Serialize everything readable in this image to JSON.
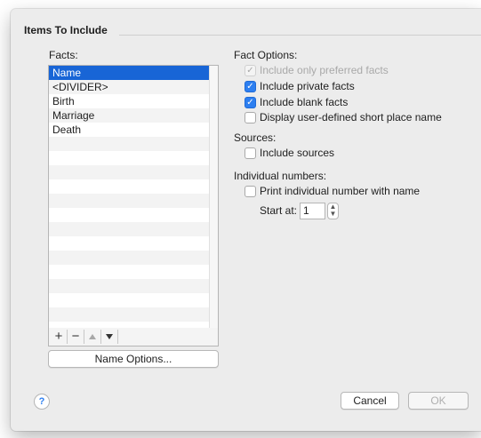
{
  "group": {
    "title": "Items To Include"
  },
  "facts": {
    "label": "Facts:",
    "items": [
      "Name",
      "<DIVIDER>",
      "Birth",
      "Marriage",
      "Death"
    ],
    "selected_index": 0,
    "toolbar": {
      "add": "+",
      "remove": "−"
    },
    "name_options_button": "Name Options..."
  },
  "fact_options": {
    "label": "Fact Options:",
    "include_only_preferred": {
      "label": "Include only preferred facts",
      "checked": true,
      "enabled": false
    },
    "include_private": {
      "label": "Include private facts",
      "checked": true,
      "enabled": true
    },
    "include_blank": {
      "label": "Include blank facts",
      "checked": true,
      "enabled": true
    },
    "display_short_place": {
      "label": "Display user-defined short place name",
      "checked": false,
      "enabled": true
    }
  },
  "sources": {
    "label": "Sources:",
    "include_sources": {
      "label": "Include sources",
      "checked": false
    }
  },
  "individual_numbers": {
    "label": "Individual numbers:",
    "print_number": {
      "label": "Print individual number with name",
      "checked": false
    },
    "start_at_label": "Start at:",
    "start_at_value": "1"
  },
  "footer": {
    "help": "?",
    "cancel": "Cancel",
    "ok": "OK"
  },
  "colors": {
    "selection": "#1865d6",
    "checkbox_accent": "#2d7ff0",
    "panel_bg": "#ececec"
  }
}
